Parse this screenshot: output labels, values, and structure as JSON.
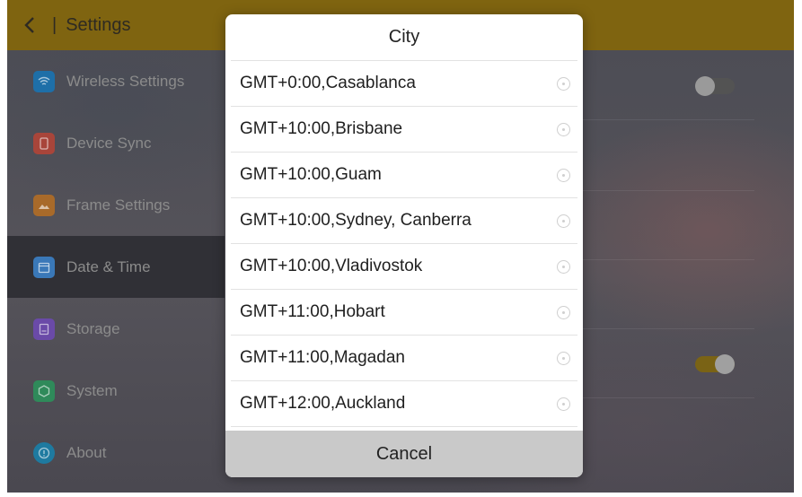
{
  "header": {
    "back_glyph": "‹",
    "separator": "|",
    "title": "Settings"
  },
  "sidebar": {
    "items": [
      {
        "label": "Wireless Settings",
        "icon": "wifi-icon",
        "color": "#1e6fa8"
      },
      {
        "label": "Device Sync",
        "icon": "phone-icon",
        "color": "#a8453a"
      },
      {
        "label": "Frame Settings",
        "icon": "image-icon",
        "color": "#a86a2a"
      },
      {
        "label": "Date & Time",
        "icon": "calendar-icon",
        "color": "#3a78b8",
        "active": true
      },
      {
        "label": "Storage",
        "icon": "storage-icon",
        "color": "#6a4aa8"
      },
      {
        "label": "System",
        "icon": "system-icon",
        "color": "#2f8a5a"
      },
      {
        "label": "About",
        "icon": "info-icon",
        "color": "#1e7aa0"
      }
    ]
  },
  "background_toggles": [
    {
      "state": "off"
    },
    {
      "state": "on"
    }
  ],
  "dialog": {
    "title": "City",
    "options": [
      "GMT+0:00,Casablanca",
      "GMT+10:00,Brisbane",
      "GMT+10:00,Guam",
      "GMT+10:00,Sydney, Canberra",
      "GMT+10:00,Vladivostok",
      "GMT+11:00,Hobart",
      "GMT+11:00,Magadan",
      "GMT+12:00,Auckland"
    ],
    "cancel_label": "Cancel"
  },
  "colors": {
    "topbar": "#7f6410",
    "accent": "#f2c200",
    "dialog_bg": "#ffffff",
    "cancel_bg": "#c9c9c9"
  }
}
